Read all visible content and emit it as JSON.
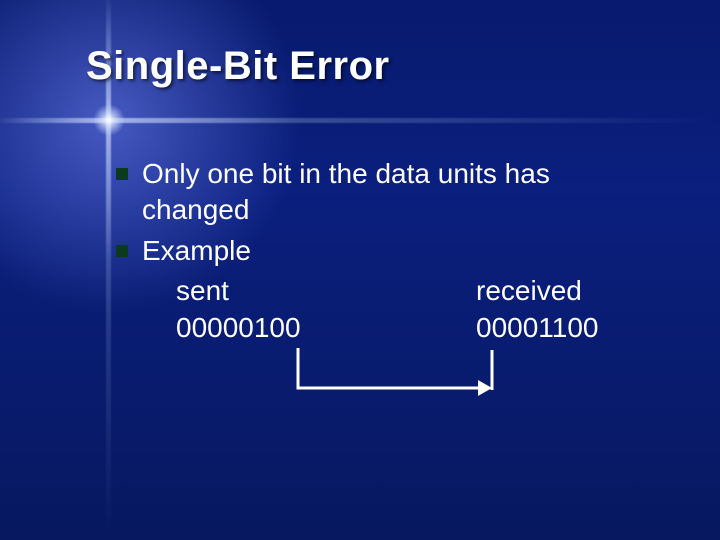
{
  "title": "Single-Bit Error",
  "bullets": [
    {
      "text": "Only one bit in the data units has changed"
    },
    {
      "text": "Example"
    }
  ],
  "example": {
    "sent_label": "sent",
    "sent_value": "00000100",
    "received_label": "received",
    "received_value": "00001100"
  }
}
